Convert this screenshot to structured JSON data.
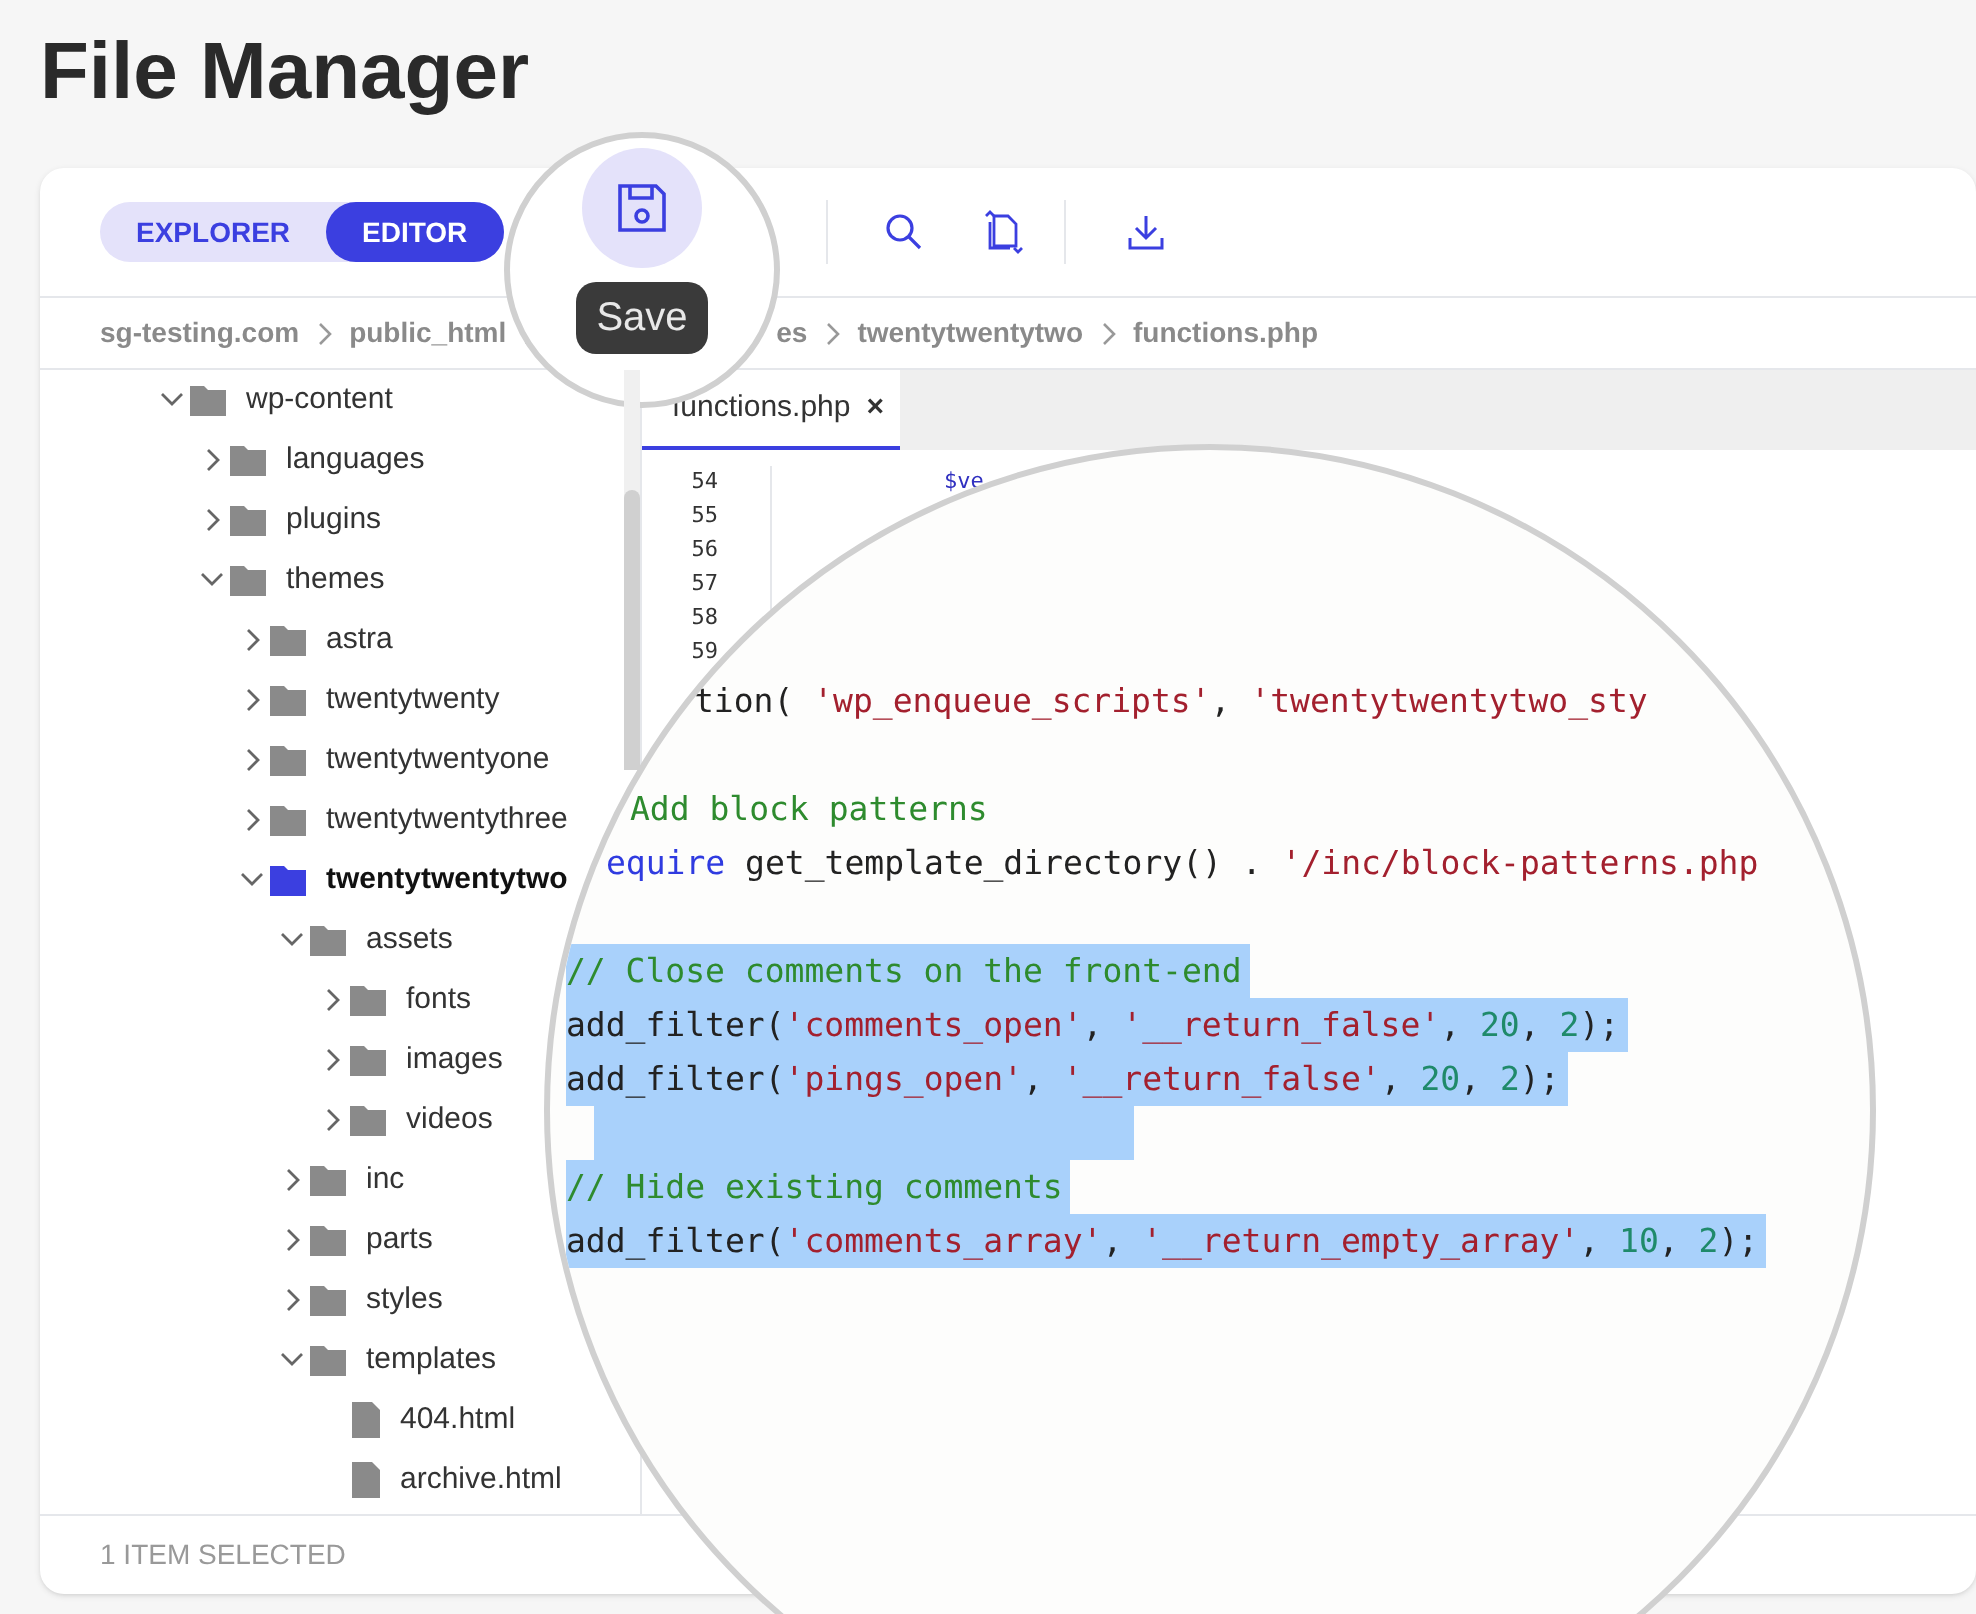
{
  "page_title": "File Manager",
  "view_toggle": [
    {
      "label": "EXPLORER",
      "selected": false
    },
    {
      "label": "EDITOR",
      "selected": true
    }
  ],
  "save_tooltip": "Save",
  "breadcrumb": [
    "sg-testing.com",
    "public_html"
  ],
  "breadcrumb_continued": [
    "es",
    "twentytwentytwo",
    "functions.php"
  ],
  "tree": [
    {
      "label": "wp-content",
      "kind": "folder",
      "expanded": true,
      "selected": false,
      "children": [
        {
          "label": "languages",
          "kind": "folder",
          "expanded": false,
          "selected": false
        },
        {
          "label": "plugins",
          "kind": "folder",
          "expanded": false,
          "selected": false
        },
        {
          "label": "themes",
          "kind": "folder",
          "expanded": true,
          "selected": false,
          "children": [
            {
              "label": "astra",
              "kind": "folder",
              "expanded": false,
              "selected": false
            },
            {
              "label": "twentytwenty",
              "kind": "folder",
              "expanded": false,
              "selected": false
            },
            {
              "label": "twentytwentyone",
              "kind": "folder",
              "expanded": false,
              "selected": false
            },
            {
              "label": "twentytwentythree",
              "kind": "folder",
              "expanded": false,
              "selected": false
            },
            {
              "label": "twentytwentytwo",
              "kind": "folder",
              "expanded": true,
              "selected": true,
              "children": [
                {
                  "label": "assets",
                  "kind": "folder",
                  "expanded": true,
                  "selected": false,
                  "children": [
                    {
                      "label": "fonts",
                      "kind": "folder",
                      "expanded": false,
                      "selected": false
                    },
                    {
                      "label": "images",
                      "kind": "folder",
                      "expanded": false,
                      "selected": false
                    },
                    {
                      "label": "videos",
                      "kind": "folder",
                      "expanded": false,
                      "selected": false
                    }
                  ]
                },
                {
                  "label": "inc",
                  "kind": "folder",
                  "expanded": false,
                  "selected": false
                },
                {
                  "label": "parts",
                  "kind": "folder",
                  "expanded": false,
                  "selected": false
                },
                {
                  "label": "styles",
                  "kind": "folder",
                  "expanded": false,
                  "selected": false
                },
                {
                  "label": "templates",
                  "kind": "folder",
                  "expanded": true,
                  "selected": false,
                  "children": [
                    {
                      "label": "404.html",
                      "kind": "file",
                      "selected": false
                    },
                    {
                      "label": "archive.html",
                      "kind": "file",
                      "selected": false
                    }
                  ]
                }
              ]
            }
          ]
        }
      ]
    }
  ],
  "editor_tab": {
    "label": "functions.php",
    "close": "×",
    "selected": true
  },
  "gutter_lines": [
    {
      "number": "54",
      "code": "$ve"
    },
    {
      "number": "55"
    },
    {
      "number": "56"
    },
    {
      "number": "57"
    },
    {
      "number": "58"
    },
    {
      "number": "59"
    }
  ],
  "magnified_code": [
    {
      "selected": false,
      "tokens": [
        {
          "kind": "plain",
          "text": "tion( "
        },
        {
          "kind": "string",
          "text": "'wp_enqueue_scripts'"
        },
        {
          "kind": "plain",
          "text": ", "
        },
        {
          "kind": "string",
          "text": "'twentytwentytwo_sty"
        }
      ]
    },
    {
      "selected": false
    },
    {
      "selected": false,
      "tokens": [
        {
          "kind": "comment",
          "text": "Add block patterns"
        }
      ]
    },
    {
      "selected": false,
      "tokens": [
        {
          "kind": "keyword",
          "text": "equire"
        },
        {
          "kind": "plain",
          "text": " get_template_directory() . "
        },
        {
          "kind": "string",
          "text": "'/inc/block-patterns.php"
        }
      ]
    },
    {
      "selected": false
    },
    {
      "selected": true,
      "tokens": [
        {
          "kind": "comment",
          "text": "// Close comments on the front-end"
        }
      ]
    },
    {
      "selected": true,
      "tokens": [
        {
          "kind": "plain",
          "text": "add_filter("
        },
        {
          "kind": "string",
          "text": "'comments_open'"
        },
        {
          "kind": "plain",
          "text": ", "
        },
        {
          "kind": "string",
          "text": "'__return_false'"
        },
        {
          "kind": "plain",
          "text": ", "
        },
        {
          "kind": "number",
          "text": "20"
        },
        {
          "kind": "plain",
          "text": ", "
        },
        {
          "kind": "number",
          "text": "2"
        },
        {
          "kind": "plain",
          "text": ");"
        }
      ]
    },
    {
      "selected": true,
      "tokens": [
        {
          "kind": "plain",
          "text": "add_filter("
        },
        {
          "kind": "string",
          "text": "'pings_open'"
        },
        {
          "kind": "plain",
          "text": ", "
        },
        {
          "kind": "string",
          "text": "'__return_false'"
        },
        {
          "kind": "plain",
          "text": ", "
        },
        {
          "kind": "number",
          "text": "20"
        },
        {
          "kind": "plain",
          "text": ", "
        },
        {
          "kind": "number",
          "text": "2"
        },
        {
          "kind": "plain",
          "text": ");"
        }
      ]
    },
    {
      "selected": true
    },
    {
      "selected": true,
      "tokens": [
        {
          "kind": "comment",
          "text": "// Hide existing comments"
        }
      ]
    },
    {
      "selected": true,
      "tokens": [
        {
          "kind": "plain",
          "text": "add_filter("
        },
        {
          "kind": "string",
          "text": "'comments_array'"
        },
        {
          "kind": "plain",
          "text": ", "
        },
        {
          "kind": "string",
          "text": "'__return_empty_array'"
        },
        {
          "kind": "plain",
          "text": ", "
        },
        {
          "kind": "number",
          "text": "10"
        },
        {
          "kind": "plain",
          "text": ", "
        },
        {
          "kind": "number",
          "text": "2"
        },
        {
          "kind": "plain",
          "text": ");"
        }
      ]
    }
  ],
  "status_bar": "1 ITEM SELECTED"
}
